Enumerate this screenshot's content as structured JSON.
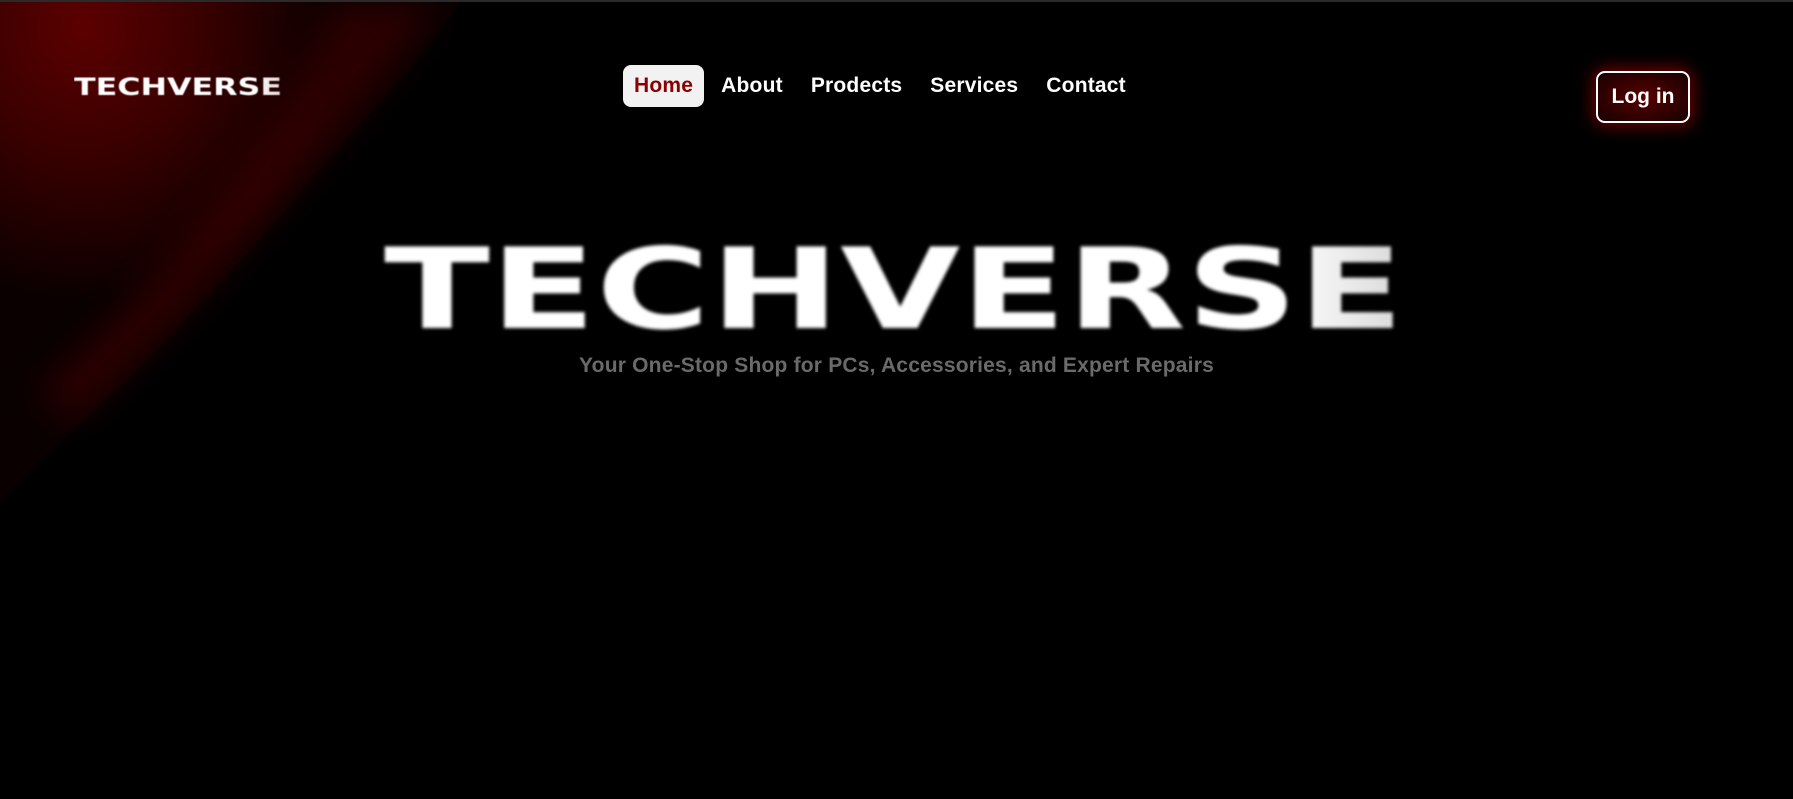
{
  "header": {
    "logo_text": "TECHVERSE",
    "nav": [
      {
        "label": "Home",
        "active": true
      },
      {
        "label": "About",
        "active": false
      },
      {
        "label": "Prodects",
        "active": false
      },
      {
        "label": "Services",
        "active": false
      },
      {
        "label": "Contact",
        "active": false
      }
    ],
    "login_label": "Log in"
  },
  "hero": {
    "logo_text": "TECHVERSE",
    "tagline": "Your One-Stop Shop for PCs, Accessories, and Expert Repairs"
  },
  "colors": {
    "background": "#000000",
    "accent": "#8b0000",
    "swoosh": "#4a0000",
    "tagline": "#6a6a6a",
    "text": "#ffffff"
  }
}
